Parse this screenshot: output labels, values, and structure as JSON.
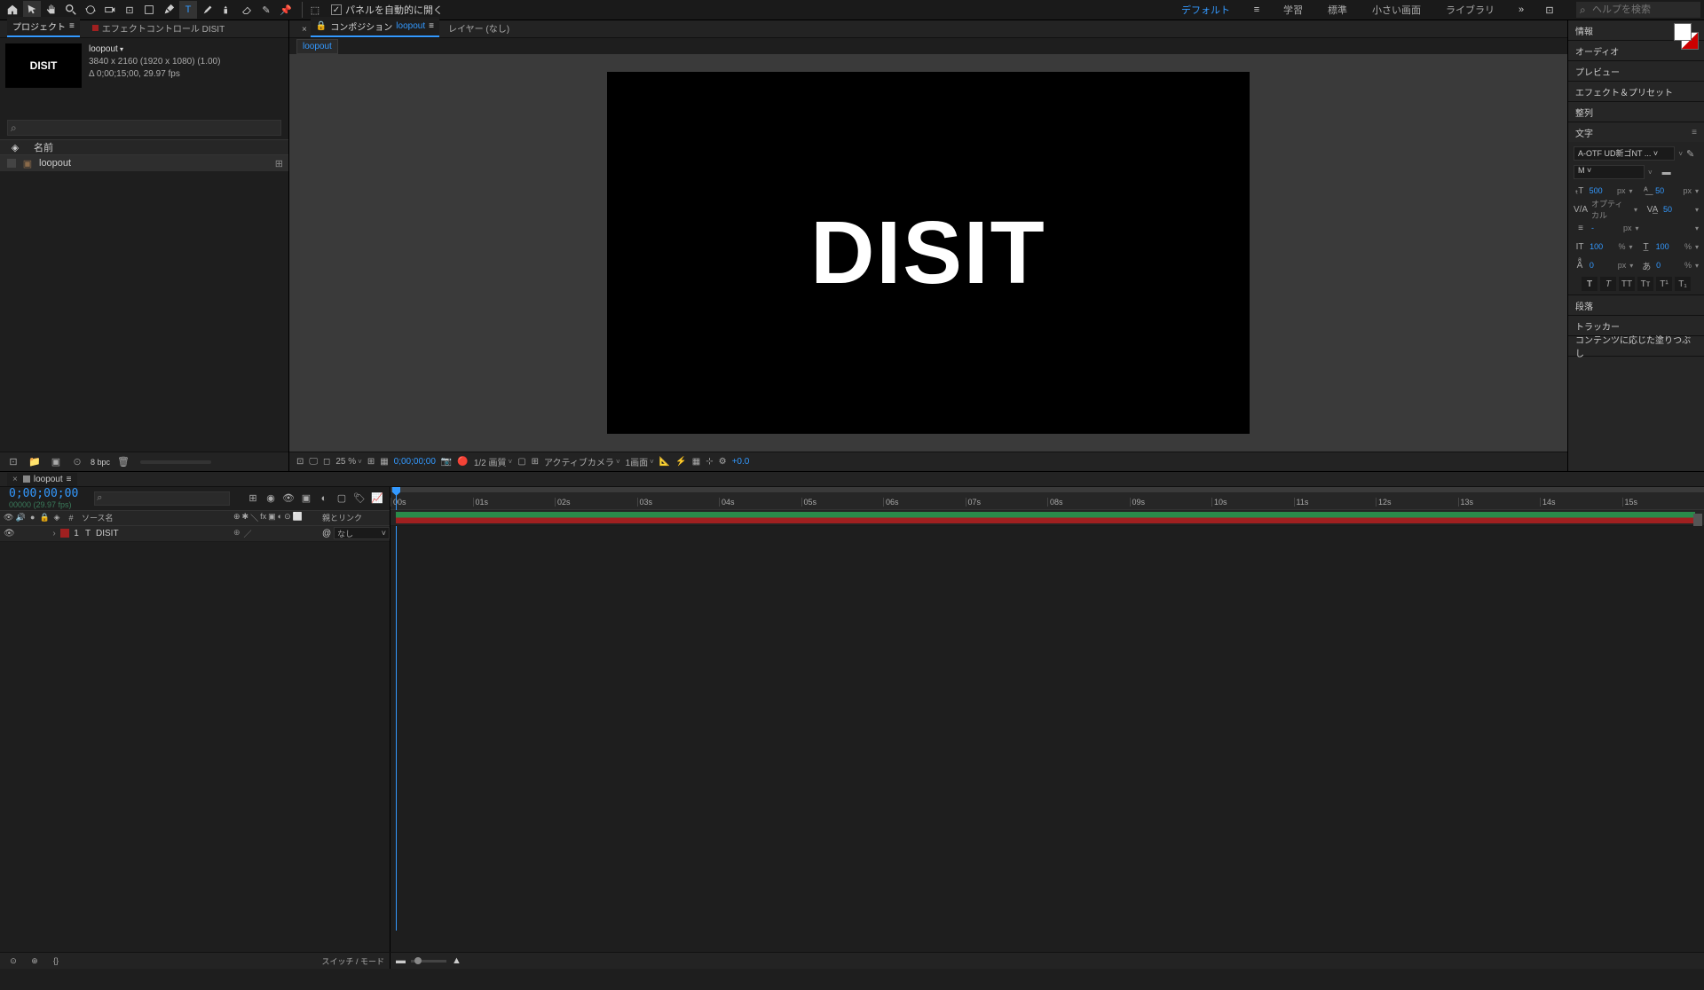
{
  "toolbar": {
    "autopanel_label": "パネルを自動的に開く"
  },
  "workspaces": {
    "default": "デフォルト",
    "learn": "学習",
    "standard": "標準",
    "small": "小さい画面",
    "library": "ライブラリ",
    "search_placeholder": "ヘルプを検索"
  },
  "project": {
    "tab_project": "プロジェクト",
    "tab_effect": "エフェクトコントロール DISIT",
    "comp_name": "loopout",
    "resolution": "3840 x 2160  (1920 x 1080) (1.00)",
    "duration": "Δ 0;00;15;00, 29.97 fps",
    "thumb_text": "DISIT",
    "col_name": "名前",
    "item1_name": "loopout",
    "footer_bpc": "8 bpc"
  },
  "viewer": {
    "tab_comp_prefix": "コンポジション",
    "tab_comp_name": "loopout",
    "tab_layer": "レイヤー (なし)",
    "subtab": "loopout",
    "canvas_text": "DISIT",
    "zoom": "25 %",
    "timecode": "0;00;00;00",
    "quality": "1/2 画質",
    "camera": "アクティブカメラ",
    "view": "1画面",
    "exposure": "+0.0"
  },
  "right": {
    "info": "情報",
    "audio": "オーディオ",
    "preview": "プレビュー",
    "effects": "エフェクト＆プリセット",
    "align": "整列",
    "character": "文字",
    "font": "A-OTF UD新ゴNT ...",
    "weight": "M",
    "size_val": "500",
    "size_unit": "px",
    "leading_val": "50",
    "leading_unit": "px",
    "kerning": "オプティカル",
    "tracking_val": "50",
    "stroke_val": "-",
    "stroke_unit": "px",
    "vscale": "100",
    "hscale": "100",
    "baseline": "0",
    "tsume": "0",
    "paragraph": "段落",
    "tracker": "トラッカー",
    "contentfill": "コンテンツに応じた塗りつぶし"
  },
  "timeline": {
    "tab_name": "loopout",
    "timecode": "0;00;00;00",
    "tc_sub": "00000 (29.97 fps)",
    "col_source": "ソース名",
    "col_parent": "親とリンク",
    "layer1_num": "1",
    "layer1_name": "DISIT",
    "layer1_parent": "なし",
    "footer_switches": "スイッチ / モード",
    "marks": [
      "00s",
      "01s",
      "02s",
      "03s",
      "04s",
      "05s",
      "06s",
      "07s",
      "08s",
      "09s",
      "10s",
      "11s",
      "12s",
      "13s",
      "14s",
      "15s"
    ]
  }
}
